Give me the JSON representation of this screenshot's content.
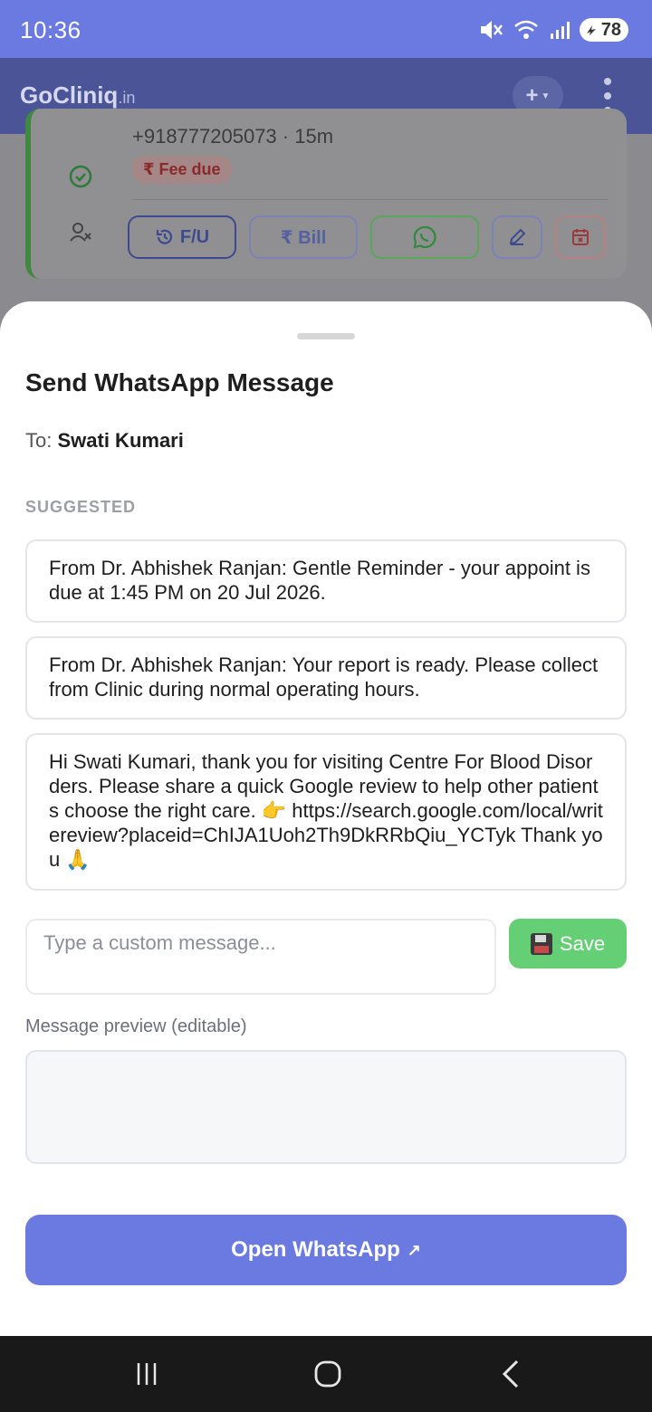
{
  "status_bar": {
    "time": "10:36",
    "battery": "78"
  },
  "app": {
    "logo": "GoCliniq",
    "logo_suffix": ".in",
    "add_label": "+"
  },
  "background_card": {
    "phone": "+918777205073 · 15m",
    "fee_badge": "₹ Fee due",
    "buttons": {
      "followup": "F/U",
      "bill": "₹ Bill"
    }
  },
  "sheet": {
    "title": "Send WhatsApp Message",
    "to_label": "To:",
    "recipient": "Swati Kumari",
    "section_label": "SUGGESTED",
    "suggestions": [
      "From Dr. Abhishek Ranjan: Gentle Reminder - your appoint is due at 1:45 PM on 20 Jul 2026.",
      "From Dr. Abhishek Ranjan: Your report is ready. Please collect from Clinic during normal operating hours.",
      "Hi Swati Kumari, thank you for visiting Centre For Blood Disorders. Please share a quick Google review to help other patients choose the right care. 👉 https://search.google.com/local/writereview?placeid=ChIJA1Uoh2Th9DkRRbQiu_YCTyk Thank you 🙏"
    ],
    "custom_placeholder": "Type a custom message...",
    "save_label": "Save",
    "preview_label": "Message preview (editable)",
    "preview_value": "",
    "open_button": "Open WhatsApp",
    "open_button_icon": "↗"
  },
  "colors": {
    "primary": "#6b7ae0",
    "appbar": "#4a5497",
    "save_green": "#65cf75",
    "fee_red": "#8a2a2a"
  },
  "icons": [
    "mute-icon",
    "wifi-icon",
    "signal-icon",
    "battery-icon",
    "check-circle-icon",
    "user-x-icon",
    "history-icon",
    "whatsapp-icon",
    "edit-icon",
    "calendar-x-icon",
    "save-icon",
    "external-link-icon",
    "recents-icon",
    "home-icon",
    "back-icon"
  ]
}
